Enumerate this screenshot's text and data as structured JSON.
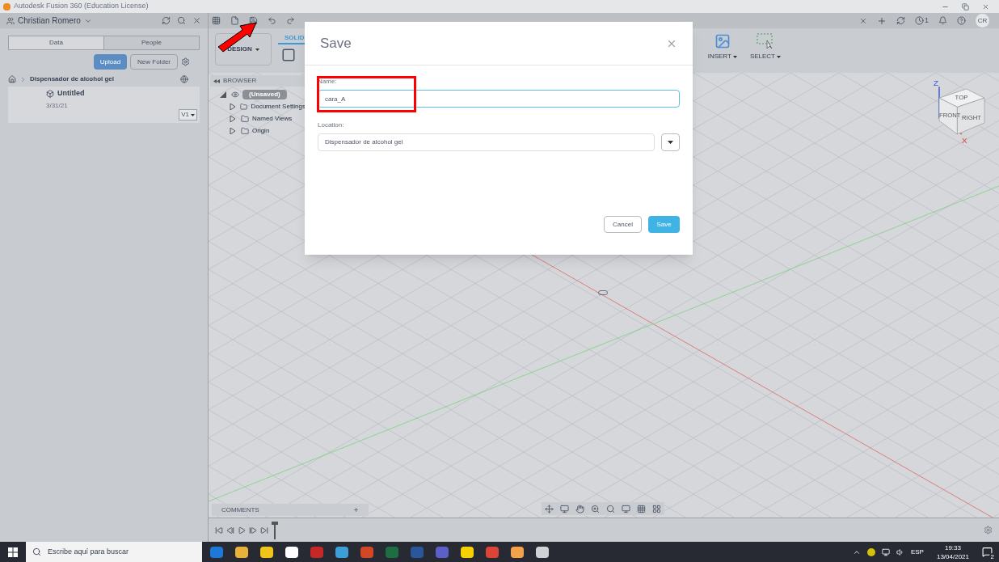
{
  "window": {
    "title": "Autodesk Fusion 360 (Education License)"
  },
  "data_panel": {
    "user": "Christian Romero",
    "tabs": [
      {
        "label": "Data",
        "selected": true
      },
      {
        "label": "People",
        "selected": false
      }
    ],
    "upload_button": "Upload",
    "new_folder_button": "New Folder",
    "breadcrumb": "Dispensador de alcohol gel",
    "files": [
      {
        "name": "Untitled",
        "date": "3/31/21",
        "version": "V1"
      }
    ]
  },
  "toolbar": {
    "workspace": "DESIGN",
    "tabs": [
      {
        "label": "SOLID",
        "selected": true
      }
    ],
    "groups": [
      "INSERT",
      "SELECT"
    ],
    "notifications_count": "1",
    "avatar": "CR"
  },
  "browser": {
    "title": "BROWSER",
    "tree": [
      {
        "label": "(Unsaved)",
        "expanded": true,
        "children": [
          {
            "label": "Document Settings",
            "expanded": false
          },
          {
            "label": "Named Views",
            "expanded": false
          },
          {
            "label": "Origin",
            "expanded": false
          }
        ]
      }
    ]
  },
  "view_cube": {
    "top": "TOP",
    "front": "FRONT",
    "right": "RIGHT",
    "z": "Z",
    "x": "X"
  },
  "comments": {
    "title": "COMMENTS"
  },
  "dialog": {
    "title": "Save",
    "name_label": "Name:",
    "name_value": "cara_A",
    "location_label": "Location:",
    "location_value": "Dispensador de alcohol gel",
    "cancel": "Cancel",
    "save": "Save"
  },
  "taskbar": {
    "search_placeholder": "Escribe aquí para buscar",
    "language": "ESP",
    "time": "19:33",
    "date": "13/04/2021",
    "notifications": "2"
  }
}
